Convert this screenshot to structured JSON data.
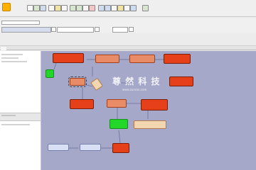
{
  "watermark": {
    "title": "尊 然 科 技",
    "subtitle": "www.zunran.com"
  },
  "icons": [
    "app-logo-icon",
    "new-icon",
    "open-icon",
    "save-icon",
    "cut-icon",
    "copy-icon",
    "paste-icon",
    "undo-icon",
    "redo-icon",
    "run-icon",
    "stop-icon",
    "zoom-in-icon",
    "zoom-out-icon",
    "fit-icon",
    "grid-icon",
    "layout-icon",
    "export-icon",
    "help-icon"
  ]
}
